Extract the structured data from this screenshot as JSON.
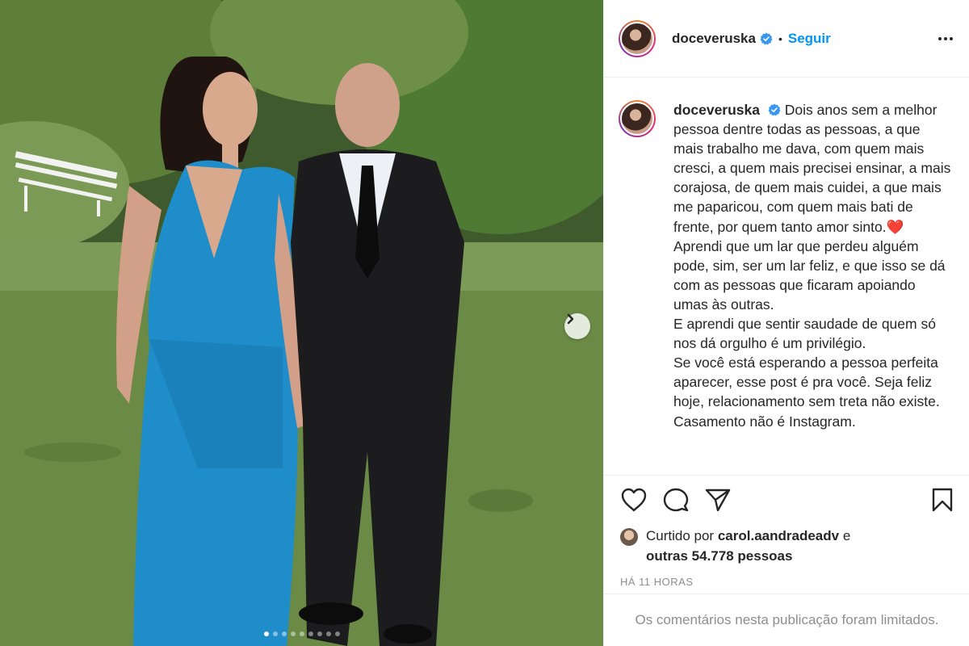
{
  "post": {
    "username": "doceveruska",
    "separator": "•",
    "follow_label": "Seguir",
    "caption_lines": [
      "Dois anos sem a melhor pessoa dentre todas as pessoas, a que mais trabalho me dava, com quem mais cresci, a quem mais precisei ensinar, a mais corajosa, de quem mais cuidei, a que mais me paparicou, com quem mais bati de frente, por quem tanto amor sinto.❤️",
      "Aprendi que um lar que perdeu alguém pode, sim, ser um lar feliz, e que isso se dá com as pessoas que ficaram apoiando umas às outras.",
      "E aprendi que sentir saudade de quem só nos dá orgulho é um privilégio.",
      "Se você está esperando a pessoa perfeita aparecer, esse post é pra você. Seja feliz hoje, relacionamento sem treta não existe. Casamento não é Instagram."
    ],
    "likes": {
      "prefix": "Curtido por",
      "liked_by": "carol.aandradeadv",
      "conjunction": "e",
      "others": "outras 54.778 pessoas"
    },
    "timestamp": "HÁ 11 HORAS",
    "comments_notice": "Os comentários nesta publicação foram limitados.",
    "carousel": {
      "slide_count": 9,
      "active_index": 0
    }
  },
  "colors": {
    "accent": "#0095f6",
    "text": "#262626",
    "muted": "#8e8e8e",
    "verified": "#3897f0"
  },
  "icons": [
    "verified-icon",
    "more-icon",
    "heart-icon",
    "comment-icon",
    "share-icon",
    "bookmark-icon",
    "chevron-right-icon"
  ]
}
